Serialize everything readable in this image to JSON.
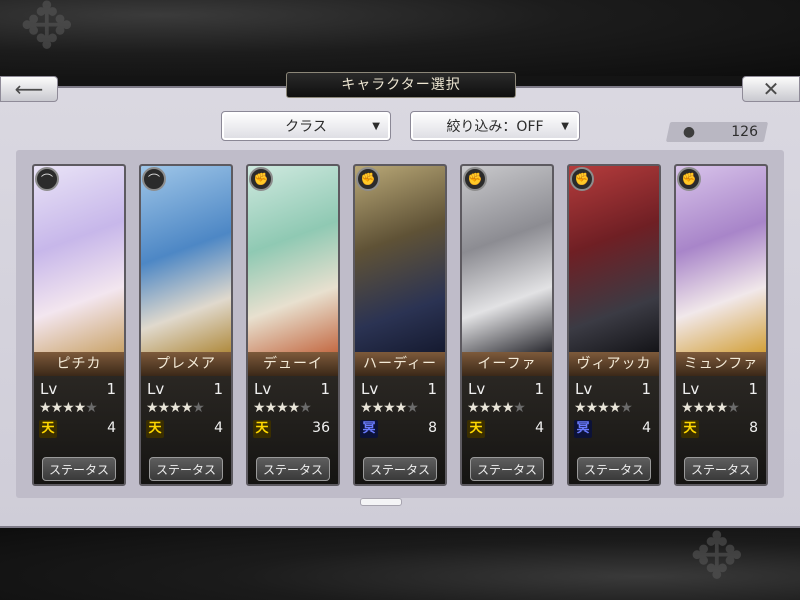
{
  "header": {
    "title": "キャラクター選択",
    "back_icon": "back-arrow-icon",
    "close_icon": "close-x-icon"
  },
  "filters": {
    "class_label": "クラス",
    "filter_label": "絞り込み：OFF"
  },
  "count": {
    "value": "126",
    "icon": "person-icon"
  },
  "common": {
    "status_label": "ステータス",
    "lv_label": "Lv"
  },
  "characters": [
    {
      "name": "ピチカ",
      "lv": "1",
      "stars": 4,
      "rank_icon": "天",
      "rank_type": "ten",
      "count": "4",
      "class_icon": "bow-icon"
    },
    {
      "name": "プレメア",
      "lv": "1",
      "stars": 4,
      "rank_icon": "天",
      "rank_type": "ten",
      "count": "4",
      "class_icon": "bow-icon"
    },
    {
      "name": "デューイ",
      "lv": "1",
      "stars": 4,
      "rank_icon": "天",
      "rank_type": "ten",
      "count": "36",
      "class_icon": "fist-icon"
    },
    {
      "name": "ハーディー",
      "lv": "1",
      "stars": 4,
      "rank_icon": "冥",
      "rank_type": "blue",
      "count": "8",
      "class_icon": "fist-icon"
    },
    {
      "name": "イーファ",
      "lv": "1",
      "stars": 4,
      "rank_icon": "天",
      "rank_type": "ten",
      "count": "4",
      "class_icon": "fist-icon"
    },
    {
      "name": "ヴィアッカ",
      "lv": "1",
      "stars": 4,
      "rank_icon": "冥",
      "rank_type": "blue",
      "count": "4",
      "class_icon": "fist-icon"
    },
    {
      "name": "ミュンファ",
      "lv": "1",
      "stars": 4,
      "rank_icon": "天",
      "rank_type": "ten",
      "count": "8",
      "class_icon": "fist-icon"
    }
  ]
}
